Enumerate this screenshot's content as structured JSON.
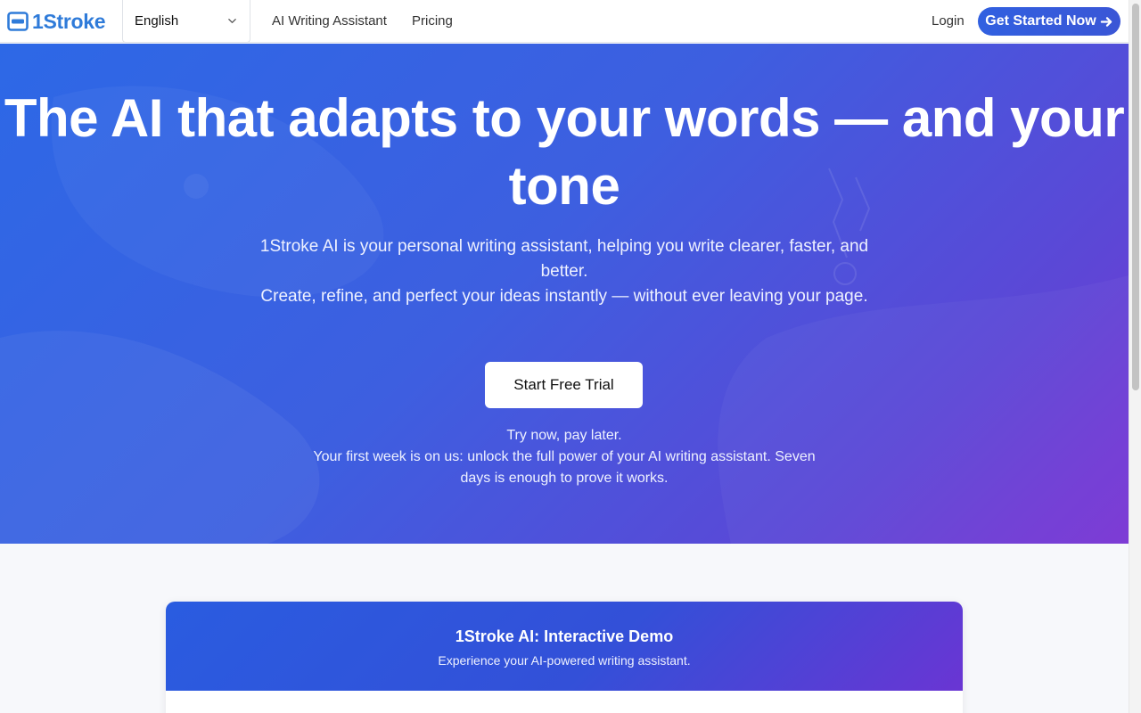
{
  "navbar": {
    "logo_text": "1Stroke",
    "language": "English",
    "links": [
      {
        "label": "AI Writing Assistant"
      },
      {
        "label": "Pricing"
      }
    ],
    "login_label": "Login",
    "cta_label": "Get Started Now"
  },
  "hero": {
    "title": "The AI that adapts to your words — and your tone",
    "subtitle_line1": "1Stroke AI is your personal writing assistant, helping you write clearer, faster, and better.",
    "subtitle_line2": "Create, refine, and perfect your ideas instantly — without ever leaving your page.",
    "trial_button": "Start Free Trial",
    "try_now": "Try now, pay later.",
    "first_week": "Your first week is on us: unlock the full power of your AI writing assistant. Seven days is enough to prove it works."
  },
  "demo": {
    "title": "1Stroke AI: Interactive Demo",
    "subtitle": "Experience your AI-powered writing assistant."
  },
  "colors": {
    "brand": "#2f7bd9",
    "cta": "#3a56d6",
    "hero_start": "#2d68e6",
    "hero_end": "#7a34d4"
  },
  "icons": [
    "logo-icon",
    "chevron-down-icon",
    "arrow-right-icon"
  ]
}
